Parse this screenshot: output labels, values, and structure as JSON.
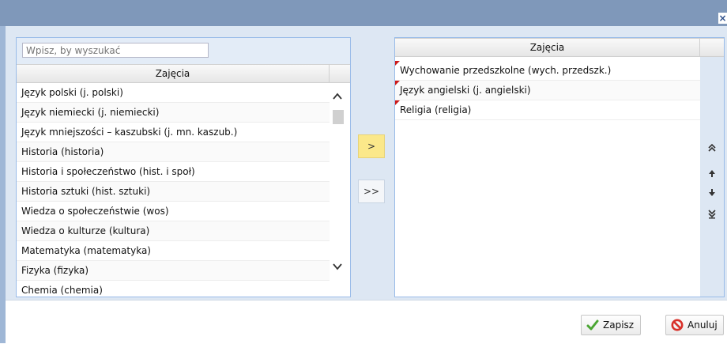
{
  "search": {
    "placeholder": "Wpisz, by wyszukać"
  },
  "left": {
    "header": "Zajęcia",
    "items": [
      "Język polski (j. polski)",
      "Język niemiecki (j. niemiecki)",
      "Język mniejszości – kaszubski (j. mn. kaszub.)",
      "Historia (historia)",
      "Historia i społeczeństwo (hist. i społ)",
      "Historia sztuki (hist. sztuki)",
      "Wiedza o społeczeństwie (wos)",
      "Wiedza o kulturze (kultura)",
      "Matematyka (matematyka)",
      "Fizyka (fizyka)",
      "Chemia (chemia)"
    ]
  },
  "middle": {
    "move_one": ">",
    "move_all": ">>"
  },
  "right": {
    "header": "Zajęcia",
    "items": [
      "Wychowanie przedszkolne (wych. przedszk.)",
      "Język angielski (j. angielski)",
      "Religia (religia)"
    ]
  },
  "footer": {
    "save": "Zapisz",
    "cancel": "Anuluj"
  },
  "titlebar": {
    "close": "×"
  },
  "colors": {
    "title": "#7f98ba",
    "body": "#dde7f3",
    "accent": "#fbe88a"
  }
}
